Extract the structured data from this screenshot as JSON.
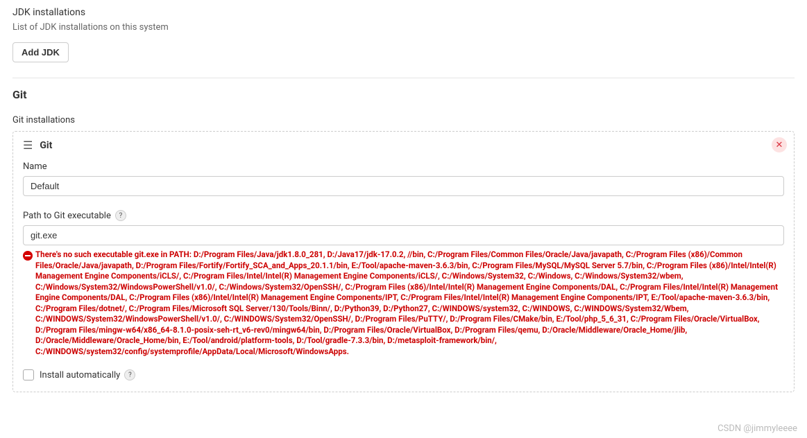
{
  "jdk": {
    "title": "JDK installations",
    "desc": "List of JDK installations on this system",
    "add_button": "Add JDK"
  },
  "git": {
    "heading": "Git",
    "installations_label": "Git installations",
    "item_title": "Git",
    "name_label": "Name",
    "name_value": "Default",
    "path_label": "Path to Git executable",
    "path_value": "git.exe",
    "error": "There's no such executable git.exe in PATH: D:/Program Files/Java/jdk1.8.0_281, D:/Java17/jdk-17.0.2, //bin, C:/Program Files/Common Files/Oracle/Java/javapath, C:/Program Files (x86)/Common Files/Oracle/Java/javapath, D:/Program Files/Fortify/Fortify_SCA_and_Apps_20.1.1/bin, E:/Tool/apache-maven-3.6.3/bin, C:/Program Files/MySQL/MySQL Server 5.7/bin, C:/Program Files (x86)/Intel/Intel(R) Management Engine Components/iCLS/, C:/Program Files/Intel/Intel(R) Management Engine Components/iCLS/, C:/Windows/System32, C:/Windows, C:/Windows/System32/wbem, C:/Windows/System32/WindowsPowerShell/v1.0/, C:/Windows/System32/OpenSSH/, C:/Program Files (x86)/Intel/Intel(R) Management Engine Components/DAL, C:/Program Files/Intel/Intel(R) Management Engine Components/DAL, C:/Program Files (x86)/Intel/Intel(R) Management Engine Components/IPT, C:/Program Files/Intel/Intel(R) Management Engine Components/IPT, E:/Tool/apache-maven-3.6.3/bin, C:/Program Files/dotnet/, C:/Program Files/Microsoft SQL Server/130/Tools/Binn/, D:/Python39, D:/Python27, C:/WINDOWS/system32, C:/WINDOWS, C:/WINDOWS/System32/Wbem, C:/WINDOWS/System32/WindowsPowerShell/v1.0/, C:/WINDOWS/System32/OpenSSH/, D:/Program Files/PuTTY/, D:/Program Files/CMake/bin, E:/Tool/php_5_6_31, C:/Program Files/Oracle/VirtualBox, D:/Program Files/mingw-w64/x86_64-8.1.0-posix-seh-rt_v6-rev0/mingw64/bin, D:/Program Files/Oracle/VirtualBox, D:/Program Files/qemu, D:/Oracle/Middleware/Oracle_Home/jlib, D:/Oracle/Middleware/Oracle_Home/bin, E:/Tool/android/platform-tools, D:/Tool/gradle-7.3.3/bin, D:/metasploit-framework/bin/, C:/WINDOWS/system32/config/systemprofile/AppData/Local/Microsoft/WindowsApps.",
    "install_auto_label": "Install automatically"
  },
  "watermark": "CSDN @jimmyleeee"
}
